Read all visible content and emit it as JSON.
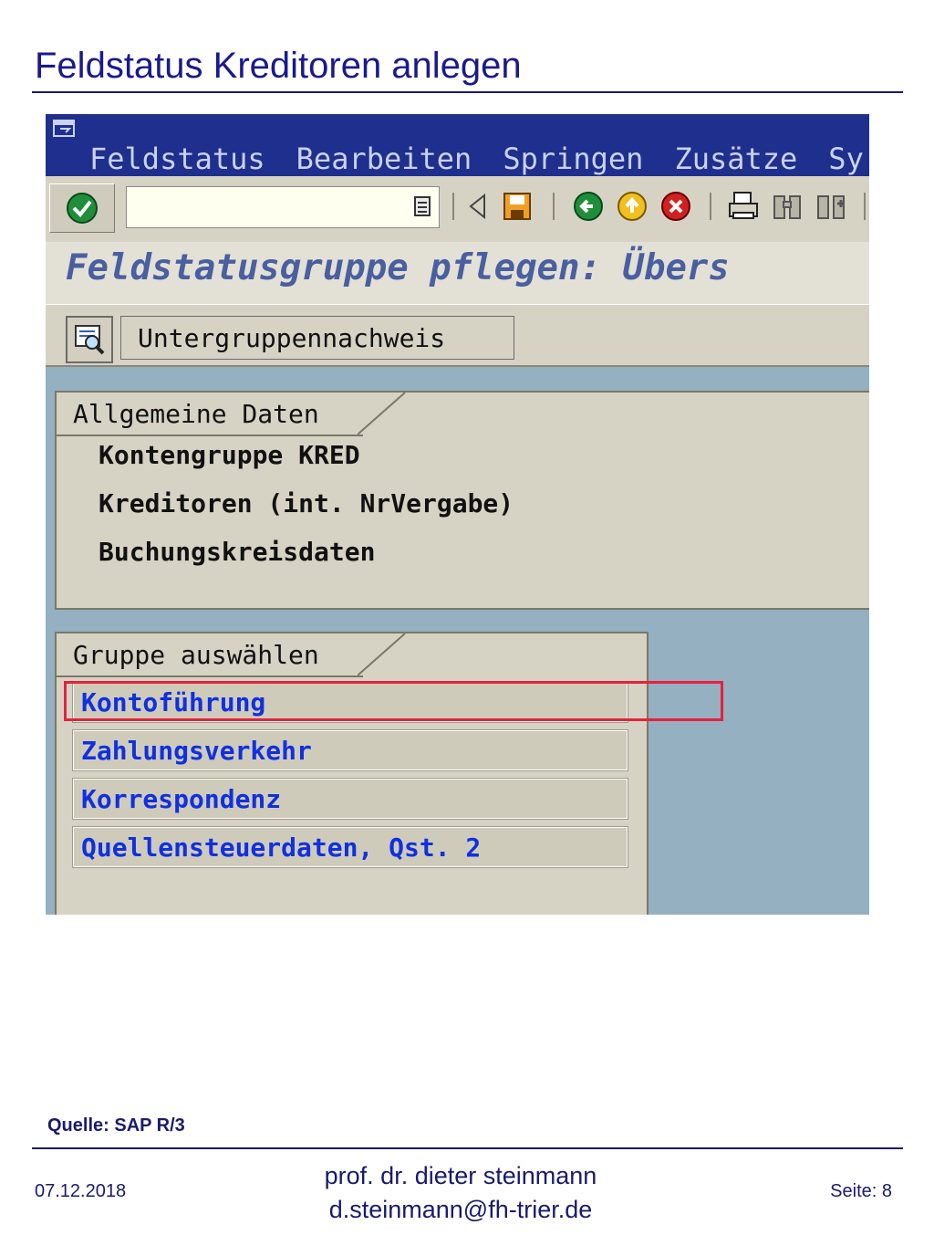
{
  "slide": {
    "title": "Feldstatus Kreditoren anlegen",
    "source": "Quelle: SAP R/3",
    "footer_date": "07.12.2018",
    "footer_author_line1": "prof. dr. dieter steinmann",
    "footer_author_line2": "d.steinmann@fh-trier.de",
    "footer_page": "Seite: 8"
  },
  "menubar": {
    "items": [
      "Feldstatus",
      "Bearbeiten",
      "Springen",
      "Zusätze",
      "Sy"
    ]
  },
  "toolbar": {
    "command_field_value": "",
    "icons": [
      "check-icon",
      "dropdown-list-icon",
      "back-triangle-icon",
      "save-icon",
      "back-icon",
      "exit-icon",
      "cancel-icon",
      "print-icon",
      "find-icon",
      "find-next-icon"
    ]
  },
  "screen": {
    "title": "Feldstatusgruppe pflegen: Übers"
  },
  "apptoolbar": {
    "subgroup_button": "Untergruppennachweis"
  },
  "general_data": {
    "tab": "Allgemeine Daten",
    "lines": [
      "Kontengruppe KRED",
      "Kreditoren (int. NrVergabe)",
      "Buchungskreisdaten"
    ]
  },
  "select_group": {
    "tab": "Gruppe auswählen",
    "items": [
      "Kontoführung",
      "Zahlungsverkehr",
      "Korrespondenz",
      "Quellensteuerdaten, Qst. 2"
    ],
    "highlighted_item": "Kontoführung"
  },
  "colors": {
    "menubar_bg": "#1f2f8e",
    "link_text": "#1030e0",
    "highlight_border": "#e8203a",
    "window_bg": "#94b0c1"
  }
}
